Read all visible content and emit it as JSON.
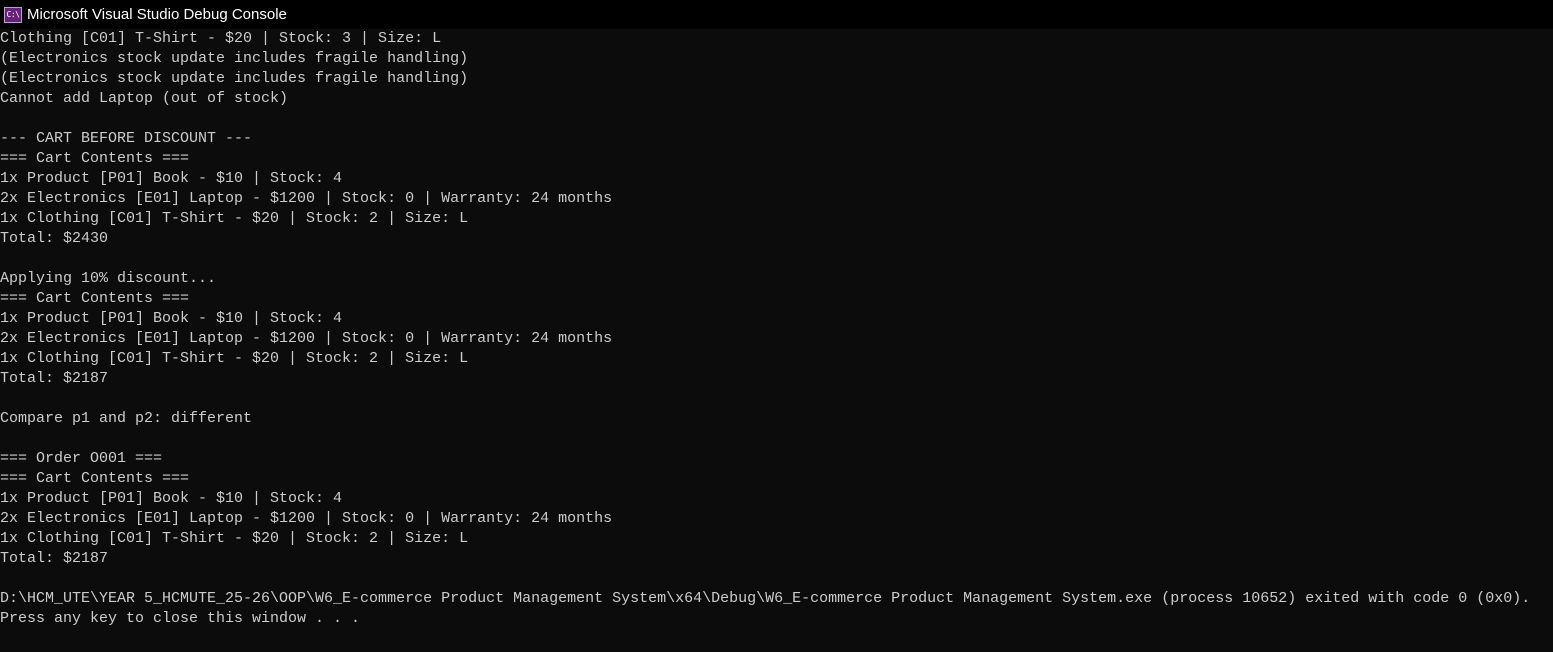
{
  "window": {
    "title": "Microsoft Visual Studio Debug Console",
    "icon_label": "C:\\"
  },
  "console": {
    "lines": [
      "Clothing [C01] T-Shirt - $20 | Stock: 3 | Size: L",
      "(Electronics stock update includes fragile handling)",
      "(Electronics stock update includes fragile handling)",
      "Cannot add Laptop (out of stock)",
      "",
      "--- CART BEFORE DISCOUNT ---",
      "=== Cart Contents ===",
      "1x Product [P01] Book - $10 | Stock: 4",
      "2x Electronics [E01] Laptop - $1200 | Stock: 0 | Warranty: 24 months",
      "1x Clothing [C01] T-Shirt - $20 | Stock: 2 | Size: L",
      "Total: $2430",
      "",
      "Applying 10% discount...",
      "=== Cart Contents ===",
      "1x Product [P01] Book - $10 | Stock: 4",
      "2x Electronics [E01] Laptop - $1200 | Stock: 0 | Warranty: 24 months",
      "1x Clothing [C01] T-Shirt - $20 | Stock: 2 | Size: L",
      "Total: $2187",
      "",
      "Compare p1 and p2: different",
      "",
      "=== Order O001 ===",
      "=== Cart Contents ===",
      "1x Product [P01] Book - $10 | Stock: 4",
      "2x Electronics [E01] Laptop - $1200 | Stock: 0 | Warranty: 24 months",
      "1x Clothing [C01] T-Shirt - $20 | Stock: 2 | Size: L",
      "Total: $2187",
      "",
      "D:\\HCM_UTE\\YEAR 5_HCMUTE_25-26\\OOP\\W6_E-commerce Product Management System\\x64\\Debug\\W6_E-commerce Product Management System.exe (process 10652) exited with code 0 (0x0).",
      "Press any key to close this window . . ."
    ]
  },
  "colors": {
    "background": "#0c0c0c",
    "titlebar": "#000000",
    "text": "#cccccc",
    "icon": "#68217a"
  }
}
